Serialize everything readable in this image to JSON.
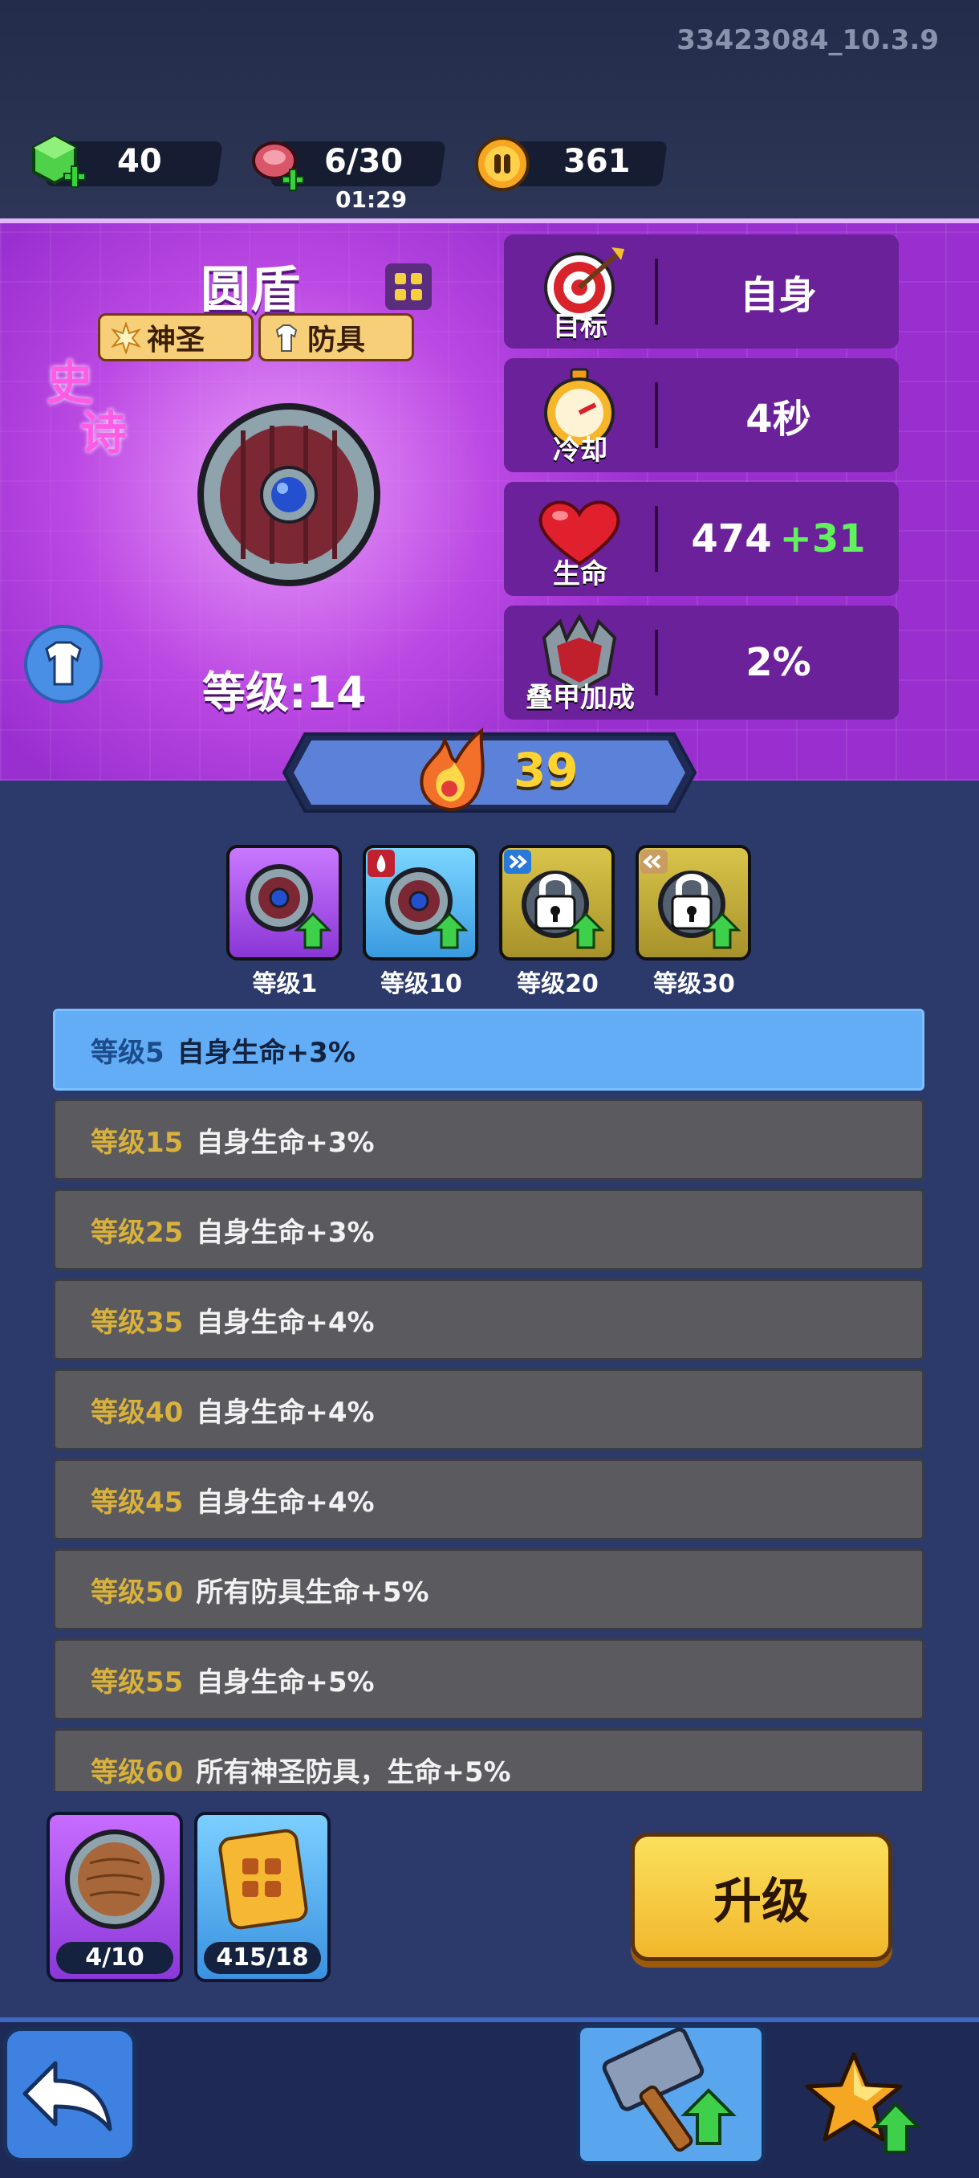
{
  "build": "33423084_10.3.9",
  "resources": {
    "gems": "40",
    "meat": "6/30",
    "meat_timer": "01:29",
    "coins": "361"
  },
  "item": {
    "name": "圆盾",
    "rarity": "史",
    "rarity2": "诗",
    "tags": [
      "神圣",
      "防具"
    ],
    "level_label": "等级:14",
    "power": "39"
  },
  "stats": [
    {
      "label": "目标",
      "value": "自身",
      "bonus": "",
      "icon": "target-icon"
    },
    {
      "label": "冷却",
      "value": "4秒",
      "bonus": "",
      "icon": "stopwatch-icon"
    },
    {
      "label": "生命",
      "value": "474",
      "bonus": "+31",
      "icon": "heart-icon"
    },
    {
      "label": "叠甲加成",
      "value": "2%",
      "bonus": "",
      "icon": "spiked-armor-icon"
    }
  ],
  "skills": [
    {
      "label": "等级1",
      "style": "purple",
      "locked": false
    },
    {
      "label": "等级10",
      "style": "blue",
      "locked": false
    },
    {
      "label": "等级20",
      "style": "gold",
      "locked": true
    },
    {
      "label": "等级30",
      "style": "gold",
      "locked": true
    }
  ],
  "level_bonuses": [
    {
      "level": "等级5",
      "desc": "自身生命+3%",
      "active": true
    },
    {
      "level": "等级15",
      "desc": "自身生命+3%",
      "active": false
    },
    {
      "level": "等级25",
      "desc": "自身生命+3%",
      "active": false
    },
    {
      "level": "等级35",
      "desc": "自身生命+4%",
      "active": false
    },
    {
      "level": "等级40",
      "desc": "自身生命+4%",
      "active": false
    },
    {
      "level": "等级45",
      "desc": "自身生命+4%",
      "active": false
    },
    {
      "level": "等级50",
      "desc": "所有防具生命+5%",
      "active": false
    },
    {
      "level": "等级55",
      "desc": "自身生命+5%",
      "active": false
    },
    {
      "level": "等级60",
      "desc": "所有神圣防具，生命+5%",
      "active": false
    }
  ],
  "materials": [
    {
      "count": "4/10",
      "icon": "wooden-shield-icon"
    },
    {
      "count": "415/18",
      "icon": "scroll-icon"
    }
  ],
  "upgrade_label": "升级",
  "colors": {
    "hero_bg": "#9a2fd0",
    "panel_bg": "#2b3a6b",
    "stat_bg": "#6b2199",
    "active_row": "#62adf6",
    "level_text": "#d9b23d",
    "bonus_green": "#5ff25a",
    "upgrade_button": "#f2b72c"
  }
}
